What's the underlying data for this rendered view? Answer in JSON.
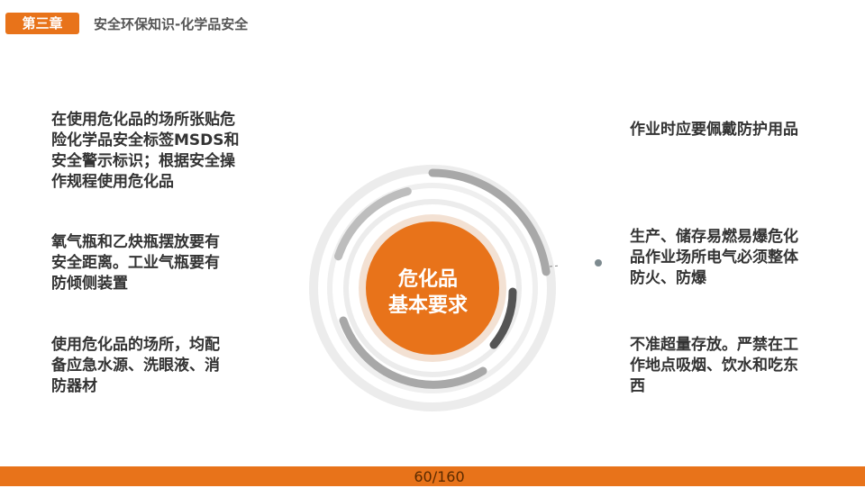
{
  "header": {
    "chapter": "第三章",
    "title": "安全环保知识-化学品安全"
  },
  "center": {
    "line1": "危化品",
    "line2": "基本要求"
  },
  "left_items": [
    "在使用危化品的场所张贴危\n险化学品安全标签MSDS和\n安全警示标识；根据安全操\n作规程使用危化品",
    "氧气瓶和乙炔瓶摆放要有\n安全距离。工业气瓶要有\n防倾侧装置",
    "使用危化品的场所，均配\n备应急水源、洗眼液、消\n防器材"
  ],
  "right_items": [
    "作业时应要佩戴防护用品",
    "生产、储存易燃易爆危化\n品作业场所电气必须整体\n防火、防爆",
    "不准超量存放。严禁在工\n作地点吸烟、饮水和吃东\n西"
  ],
  "footer": {
    "page": "60/160"
  },
  "colors": {
    "accent": "#e8731a",
    "ring_light": "#ececec",
    "arc_gray": "#a8a8a8",
    "arc_dark": "#555555"
  }
}
